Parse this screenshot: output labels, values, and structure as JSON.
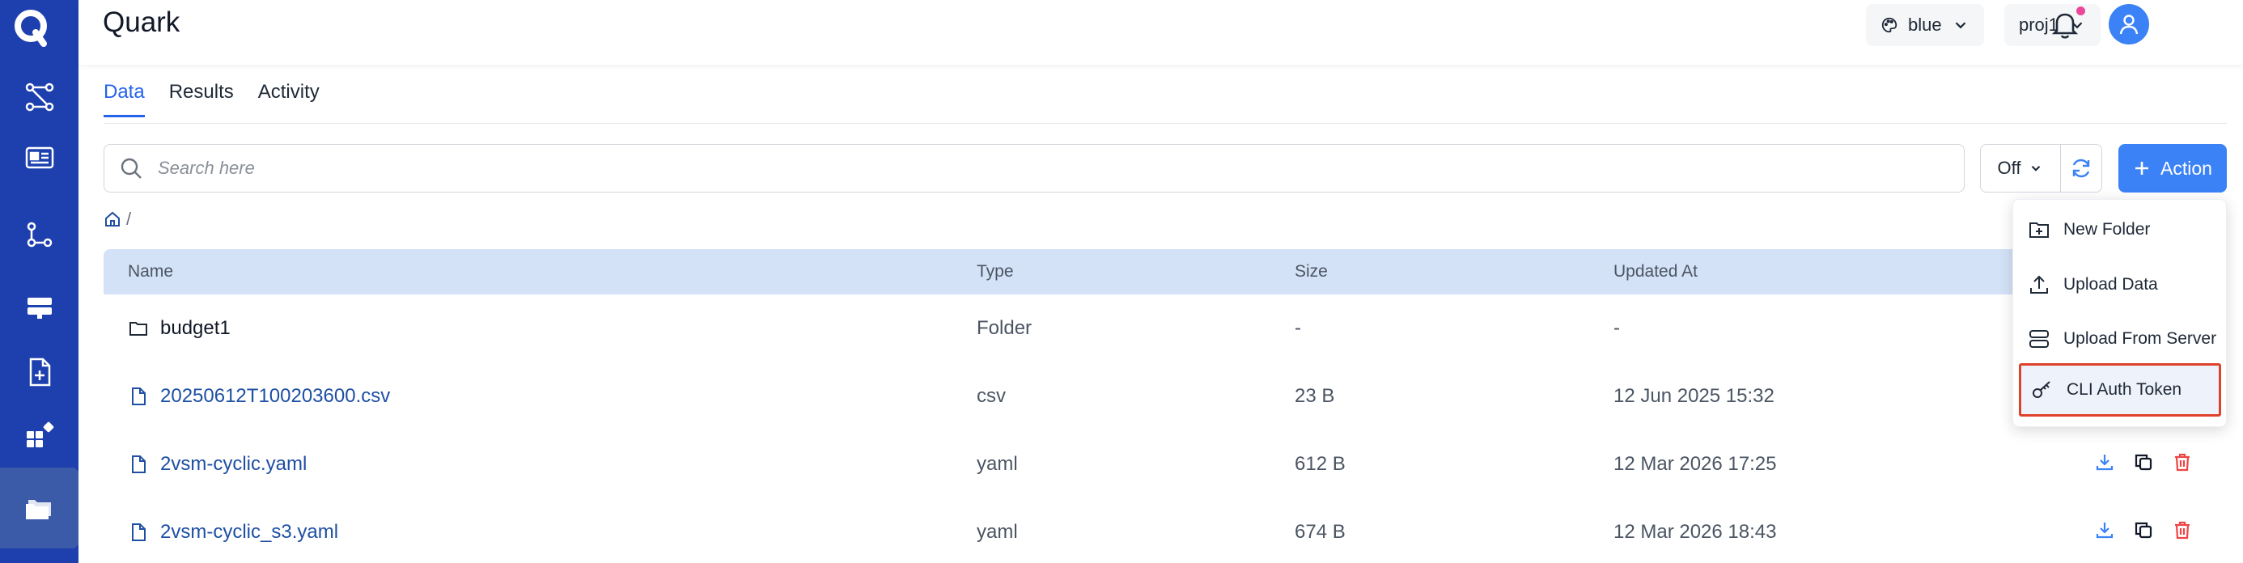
{
  "app": {
    "title": "Quark"
  },
  "header": {
    "theme_label": "blue",
    "project_label": "proj1",
    "notification_dot_color": "#ec4899"
  },
  "tabs": [
    {
      "label": "Data",
      "active": true
    },
    {
      "label": "Results",
      "active": false
    },
    {
      "label": "Activity",
      "active": false
    }
  ],
  "search": {
    "placeholder": "Search here"
  },
  "toolbar": {
    "filter_value": "Off",
    "action_label": "Action"
  },
  "breadcrumb": {
    "separator": "/"
  },
  "table": {
    "headers": {
      "name": "Name",
      "type": "Type",
      "size": "Size",
      "updated": "Updated At"
    },
    "rows": [
      {
        "name": "budget1",
        "type": "Folder",
        "size": "-",
        "updated": "-",
        "kind": "folder"
      },
      {
        "name": "20250612T100203600.csv",
        "type": "csv",
        "size": "23 B",
        "updated": "12 Jun 2025 15:32",
        "kind": "file"
      },
      {
        "name": "2vsm-cyclic.yaml",
        "type": "yaml",
        "size": "612 B",
        "updated": "12 Mar 2026 17:25",
        "kind": "file"
      },
      {
        "name": "2vsm-cyclic_s3.yaml",
        "type": "yaml",
        "size": "674 B",
        "updated": "12 Mar 2026 18:43",
        "kind": "file"
      }
    ]
  },
  "action_menu": {
    "items": [
      {
        "label": "New Folder",
        "icon": "folder-plus-icon"
      },
      {
        "label": "Upload Data",
        "icon": "upload-icon"
      },
      {
        "label": "Upload From Server",
        "icon": "server-icon"
      },
      {
        "label": "CLI Auth Token",
        "icon": "key-icon"
      }
    ]
  },
  "colors": {
    "sidebar": "#1e40af",
    "accent": "#3b82f6",
    "header_row": "#d4e2f7",
    "delete": "#ef4444",
    "highlight_border": "#e0412a"
  }
}
